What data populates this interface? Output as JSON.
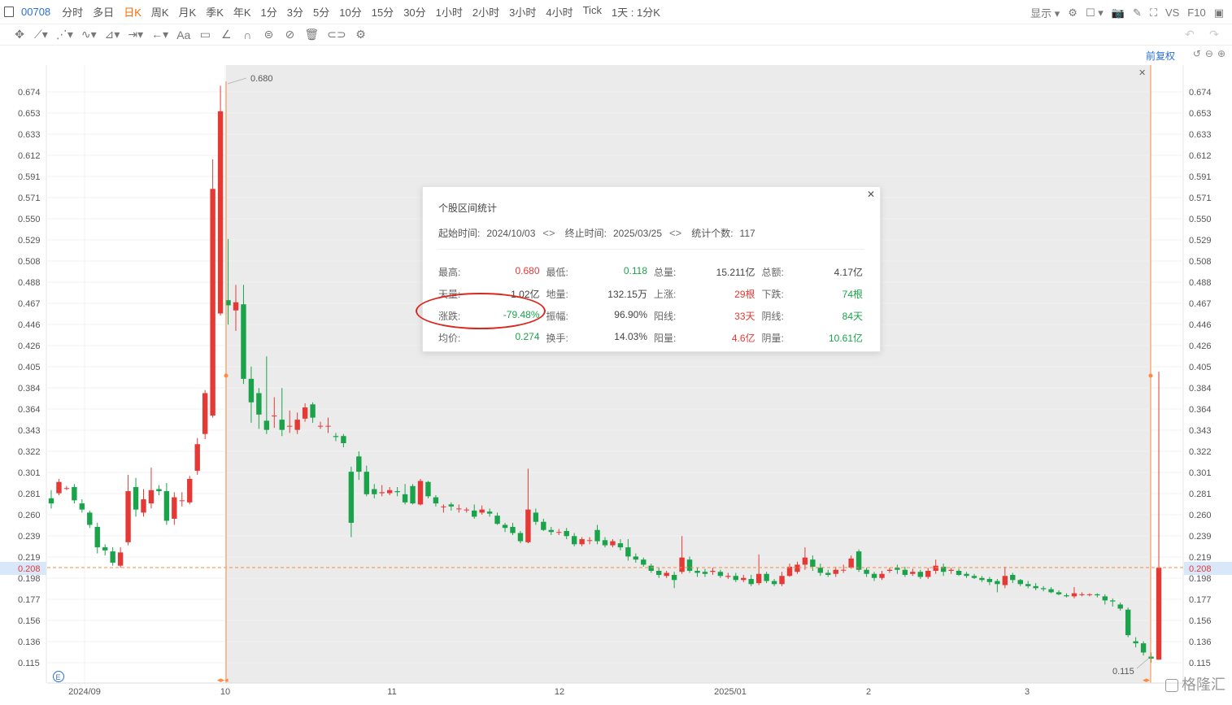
{
  "toolbar": {
    "symbol": "00708",
    "tabs": [
      {
        "label": "分时",
        "active": false
      },
      {
        "label": "多日",
        "active": false
      },
      {
        "label": "日K",
        "active": true
      },
      {
        "label": "周K",
        "active": false
      },
      {
        "label": "月K",
        "active": false
      },
      {
        "label": "季K",
        "active": false
      },
      {
        "label": "年K",
        "active": false
      },
      {
        "label": "1分",
        "active": false
      },
      {
        "label": "3分",
        "active": false
      },
      {
        "label": "5分",
        "active": false
      },
      {
        "label": "10分",
        "active": false
      },
      {
        "label": "15分",
        "active": false
      },
      {
        "label": "30分",
        "active": false
      },
      {
        "label": "1小时",
        "active": false
      },
      {
        "label": "2小时",
        "active": false
      },
      {
        "label": "3小时",
        "active": false
      },
      {
        "label": "4小时",
        "active": false
      },
      {
        "label": "Tick",
        "active": false,
        "dot": true
      },
      {
        "label": "1天 : 1分K",
        "active": false,
        "dot": true
      }
    ],
    "display_label": "显示",
    "vs_label": "VS",
    "f10_label": "F10",
    "adjust_label": "前复权"
  },
  "popup": {
    "title": "个股区间统计",
    "start_label": "起始时间:",
    "start_value": "2024/10/03",
    "end_label": "终止时间:",
    "end_value": "2025/03/25",
    "count_label": "统计个数:",
    "count_value": "117",
    "rows": [
      [
        {
          "k": "最高:",
          "v": "0.680",
          "c": "red"
        },
        {
          "k": "最低:",
          "v": "0.118",
          "c": "green"
        },
        {
          "k": "总量:",
          "v": "15.211亿",
          "c": "dark"
        },
        {
          "k": "总额:",
          "v": "4.17亿",
          "c": "dark"
        }
      ],
      [
        {
          "k": "天量:",
          "v": "1.02亿",
          "c": "dark"
        },
        {
          "k": "地量:",
          "v": "132.15万",
          "c": "dark"
        },
        {
          "k": "上涨:",
          "v": "29根",
          "c": "red"
        },
        {
          "k": "下跌:",
          "v": "74根",
          "c": "green"
        }
      ],
      [
        {
          "k": "涨跌:",
          "v": "-79.48%",
          "c": "green"
        },
        {
          "k": "振幅:",
          "v": "96.90%",
          "c": "dark"
        },
        {
          "k": "阳线:",
          "v": "33天",
          "c": "red"
        },
        {
          "k": "阴线:",
          "v": "84天",
          "c": "green"
        }
      ],
      [
        {
          "k": "均价:",
          "v": "0.274",
          "c": "green"
        },
        {
          "k": "换手:",
          "v": "14.03%",
          "c": "dark"
        },
        {
          "k": "阳量:",
          "v": "4.6亿",
          "c": "red"
        },
        {
          "k": "阴量:",
          "v": "10.61亿",
          "c": "green"
        }
      ]
    ]
  },
  "chart_data": {
    "type": "candlestick",
    "y_ticks": [
      "0.674",
      "0.653",
      "0.633",
      "0.612",
      "0.591",
      "0.571",
      "0.550",
      "0.529",
      "0.508",
      "0.488",
      "0.467",
      "0.446",
      "0.426",
      "0.405",
      "0.384",
      "0.364",
      "0.343",
      "0.322",
      "0.301",
      "0.281",
      "0.260",
      "0.239",
      "0.219",
      "0.198",
      "0.177",
      "0.156",
      "0.136",
      "0.115"
    ],
    "ylim": [
      0.115,
      0.674
    ],
    "x_labels": [
      "2024/09",
      "10",
      "11",
      "12",
      "2025/01",
      "2",
      "3"
    ],
    "high_label": "0.680",
    "low_label": "0.115",
    "current_price": "0.208",
    "colors": {
      "up": "#e53935",
      "down": "#1aa34a",
      "marker": "#ff8a3d"
    }
  },
  "watermark": "格隆汇"
}
